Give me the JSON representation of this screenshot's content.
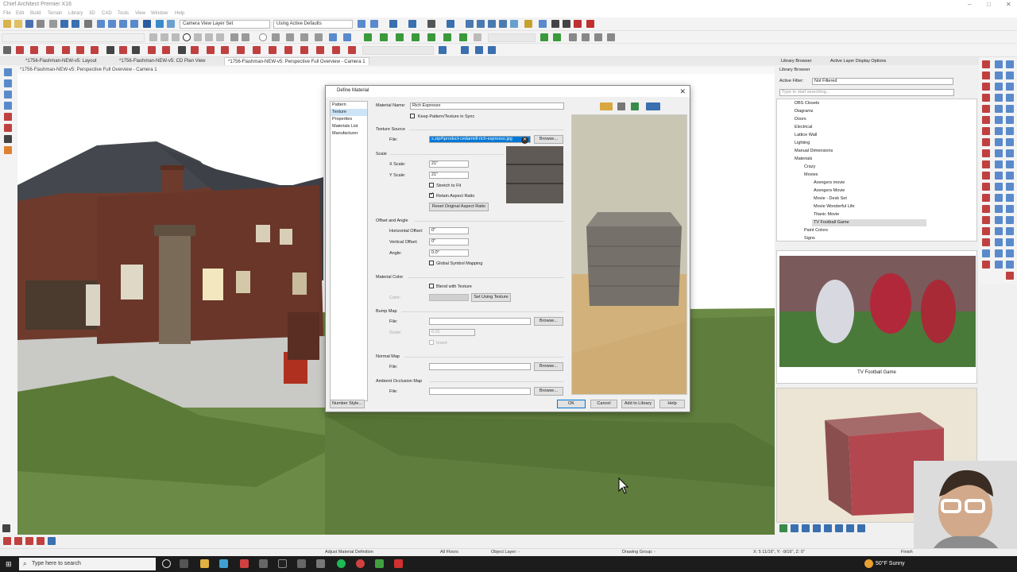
{
  "app": {
    "title": "Chief Architect Premier X16",
    "menus": [
      "File",
      "Edit",
      "Build",
      "Terrain",
      "Library",
      "3D",
      "CAD",
      "Tools",
      "View",
      "Window",
      "Help"
    ],
    "layer_set": "Camera View Layer Set",
    "defaults": "Using Active Defaults"
  },
  "tabs": [
    {
      "label": "*1756-Flashman-NEW-v5: Layout",
      "active": false
    },
    {
      "label": "*1756-Flashman-NEW-v5: CD Plan View",
      "active": false
    },
    {
      "label": "*1756-Flashman-NEW-v5: Perspective Full Overview - Camera 1",
      "active": true
    }
  ],
  "view_title": "*1756-Flashman-NEW-v5: Perspective Full Overview - Camera 1",
  "dialog": {
    "title": "Define Material",
    "nav": [
      "Pattern",
      "Texture",
      "Properties",
      "Materials List",
      "Manufacturer"
    ],
    "nav_selected": "Texture",
    "material_name_label": "Material Name:",
    "material_name": "Rich Espresso",
    "keep_sync": "Keep Pattern/Texture in Sync",
    "texture_source": "Texture Source",
    "file_label": "File:",
    "file_value": "s.zip#\\product-cedarmill-rich-espresso.jpg",
    "browse": "Browse...",
    "scale": "Scale",
    "x_scale_label": "X Scale:",
    "x_scale": "21\"",
    "y_scale_label": "Y Scale:",
    "y_scale": "21\"",
    "stretch": "Stretch to Fit",
    "retain": "Retain Aspect Ratio",
    "reset": "Reset Original Aspect Ratio",
    "offset_angle": "Offset and Angle",
    "h_offset_label": "Horizontal Offset:",
    "h_offset": "0\"",
    "v_offset_label": "Vertical Offset:",
    "v_offset": "0\"",
    "angle_label": "Angle:",
    "angle": "0.0°",
    "global_symbol": "Global Symbol Mapping",
    "material_color": "Material Color",
    "blend": "Blend with Texture",
    "color_label": "Color:",
    "set_using": "Set Using Texture",
    "bump_map": "Bump Map",
    "scale_label": "Scale:",
    "bump_scale": "0.01",
    "invert": "Invert",
    "normal_map": "Normal Map",
    "ao_map": "Ambient Occlusion Map",
    "number_style": "Number Style...",
    "ok": "OK",
    "cancel": "Cancel",
    "add_to_library": "Add to Library",
    "help": "Help"
  },
  "library": {
    "tabs": [
      "Library Browser",
      "Active Layer Display Options"
    ],
    "panel_title": "Library Browser",
    "filter_label": "Active Filter:",
    "filter_value": "Not Filtered",
    "search_placeholder": "Type to start searching...",
    "tree": [
      {
        "label": "DBS Closets",
        "level": 1
      },
      {
        "label": "Diagramz",
        "level": 1
      },
      {
        "label": "Doors",
        "level": 1
      },
      {
        "label": "Electrical",
        "level": 1
      },
      {
        "label": "Lattice Wall",
        "level": 1
      },
      {
        "label": "Lighting",
        "level": 1
      },
      {
        "label": "Manual Dimensions",
        "level": 1
      },
      {
        "label": "Materials",
        "level": 1
      },
      {
        "label": "Crazy",
        "level": 2
      },
      {
        "label": "Movies",
        "level": 2
      },
      {
        "label": "Avengers movie",
        "level": 3
      },
      {
        "label": "Avengers Movie",
        "level": 3
      },
      {
        "label": "Movie - Desk Set",
        "level": 3
      },
      {
        "label": "Movie Wonderful Life",
        "level": 3
      },
      {
        "label": "Titanic Movie",
        "level": 3
      },
      {
        "label": "TV Football Game",
        "level": 3
      },
      {
        "label": "Paint Colors",
        "level": 2
      },
      {
        "label": "Signs",
        "level": 2
      }
    ],
    "selected": "TV Football Game",
    "preview_caption": "TV Football Game"
  },
  "status": {
    "action": "Adjust Material Definition",
    "floors": "All Floors",
    "layer": "Object Layer: -",
    "group": "Drawing Group: -",
    "coords": "X: 5 11/16\", Y: -9/16\", Z: 0\"",
    "finish": "Finish"
  },
  "taskbar": {
    "search": "Type here to search",
    "weather": "50°F  Sunny"
  },
  "colors": {
    "accent": "#0078d7",
    "selection": "#cce4f7",
    "grass": "#5f7d3c",
    "brick": "#6e3a2c"
  }
}
